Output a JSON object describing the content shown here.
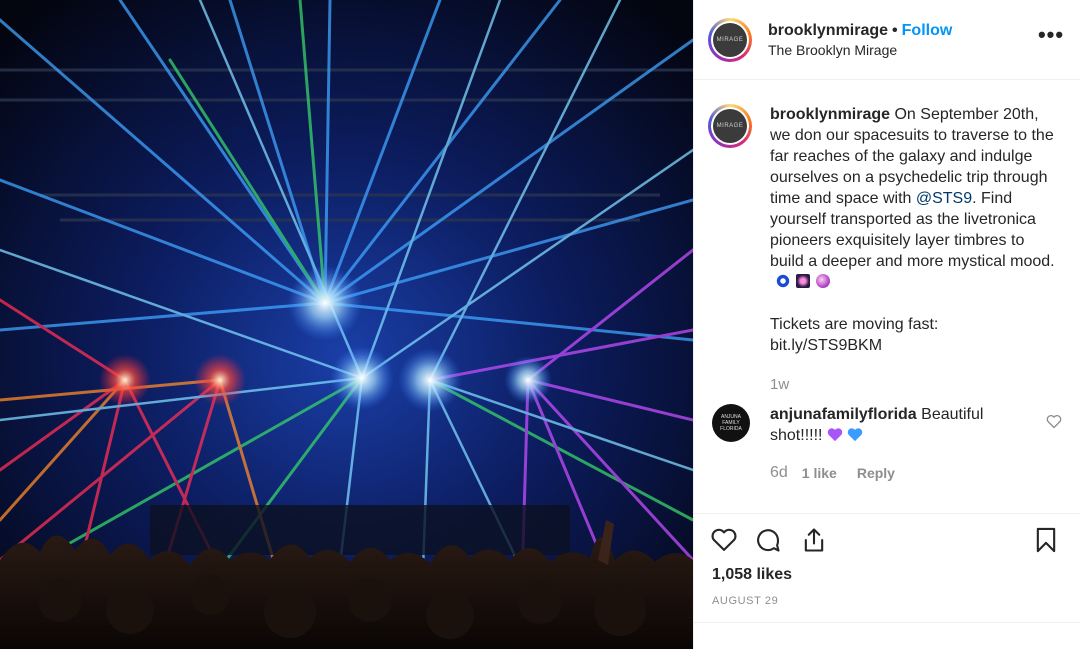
{
  "post": {
    "username": "brooklynmirage",
    "dot": "•",
    "follow_label": "Follow",
    "location": "The Brooklyn Mirage",
    "avatar_text": "MIRAGE",
    "more_label": "•••"
  },
  "caption": {
    "username": "brooklynmirage",
    "text_part1": " On September 20th, we don our spacesuits to traverse to the far reaches of the galaxy and indulge ourselves on a psychedelic trip through time and space with ",
    "mention": "@STS9",
    "text_part2": ". Find yourself transported as the livetronica pioneers exquisitely layer timbres to build a deeper and more mystical mood.",
    "tickets_line": "Tickets are moving fast:",
    "link": "bit.ly/STS9BKM",
    "time": "1w",
    "emojis": [
      "blue-eye-emoji",
      "sparkle-emoji",
      "crystal-ball-emoji"
    ]
  },
  "comment": {
    "username": "anjunafamilyflorida",
    "text": " Beautiful shot!!!!! ",
    "avatar_text": "ANJUNA FAMILY FLORIDA",
    "age": "6d",
    "likes": "1 like",
    "reply_label": "Reply",
    "emojis": [
      "purple-heart-emoji",
      "blue-heart-emoji"
    ]
  },
  "stats": {
    "likes": "1,058 likes",
    "date": "AUGUST 29"
  },
  "colors": {
    "accent": "#0095f6",
    "muted": "#8e8e8e",
    "text": "#262626"
  }
}
